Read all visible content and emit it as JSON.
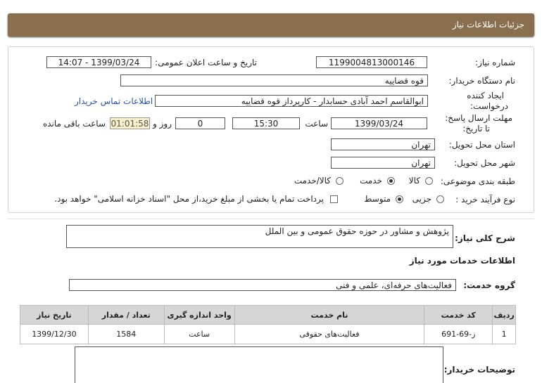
{
  "header": {
    "title": "جزئیات اطلاعات نیاز"
  },
  "form": {
    "need_number_label": "شماره نیاز:",
    "need_number": "1199004813000146",
    "announce_label": "تاریخ و ساعت اعلان عمومی:",
    "announce_value": "1399/03/24 - 14:07",
    "buyer_org_label": "نام دستگاه خریدار:",
    "buyer_org": "قوه قضاییه",
    "creator_label_1": "ایجاد کننده",
    "creator_label_2": "درخواست:",
    "creator": "ابوالقاسم احمد آبادی حسابدار - کارپرداز قوه قضاییه",
    "contact_link": "اطلاعات تماس خریدار",
    "deadline_label_1": "مهلت ارسال پاسخ:",
    "deadline_label_2": "تا تاریخ:",
    "deadline_date": "1399/03/24",
    "time_label": "ساعت",
    "deadline_time": "15:30",
    "days_value": "0",
    "days_label": "روز و",
    "remaining_time": "01:01:58",
    "remaining_label": "ساعت باقی مانده",
    "province_label": "استان محل تحویل:",
    "province": "تهران",
    "city_label": "شهر محل تحویل:",
    "city": "تهران",
    "category_label": "طبقه بندی موضوعی:",
    "category_options": [
      "کالا",
      "خدمت",
      "کالا/خدمت"
    ],
    "category_selected": "خدمت",
    "process_label": "نوع فرآیند خرید :",
    "process_options": [
      "جزیی",
      "متوسط"
    ],
    "process_selected": "متوسط",
    "treasury_note": "پرداخت تمام یا بخشی از مبلغ خرید،از محل \"اسناد خزانه اسلامی\" خواهد بود."
  },
  "description": {
    "label": "شرح کلی نیاز:",
    "value": "پژوهش و مشاور در حوزه حقوق عمومی و بین الملل"
  },
  "services": {
    "section_title": "اطلاعات خدمات مورد نیاز",
    "group_label": "گروه خدمت:",
    "group_value": "فعالیت‌های حرفه‌ای، علمی و فنی",
    "columns": [
      "ردیف",
      "کد خدمت",
      "نام خدمت",
      "واحد اندازه گیری",
      "تعداد / مقدار",
      "تاریخ نیاز"
    ],
    "rows": [
      {
        "row": "1",
        "code": "ز-69-691",
        "name": "فعالیت‌های حقوقی",
        "unit": "ساعت",
        "qty": "1584",
        "date": "1399/12/30"
      }
    ]
  },
  "buyer_notes": {
    "label": "توضیحات خریدار:",
    "value": ""
  },
  "colors": {
    "header_bg": "#8a6f4e",
    "link": "#2a4fa8",
    "timer_bg": "#f7f0c8"
  }
}
